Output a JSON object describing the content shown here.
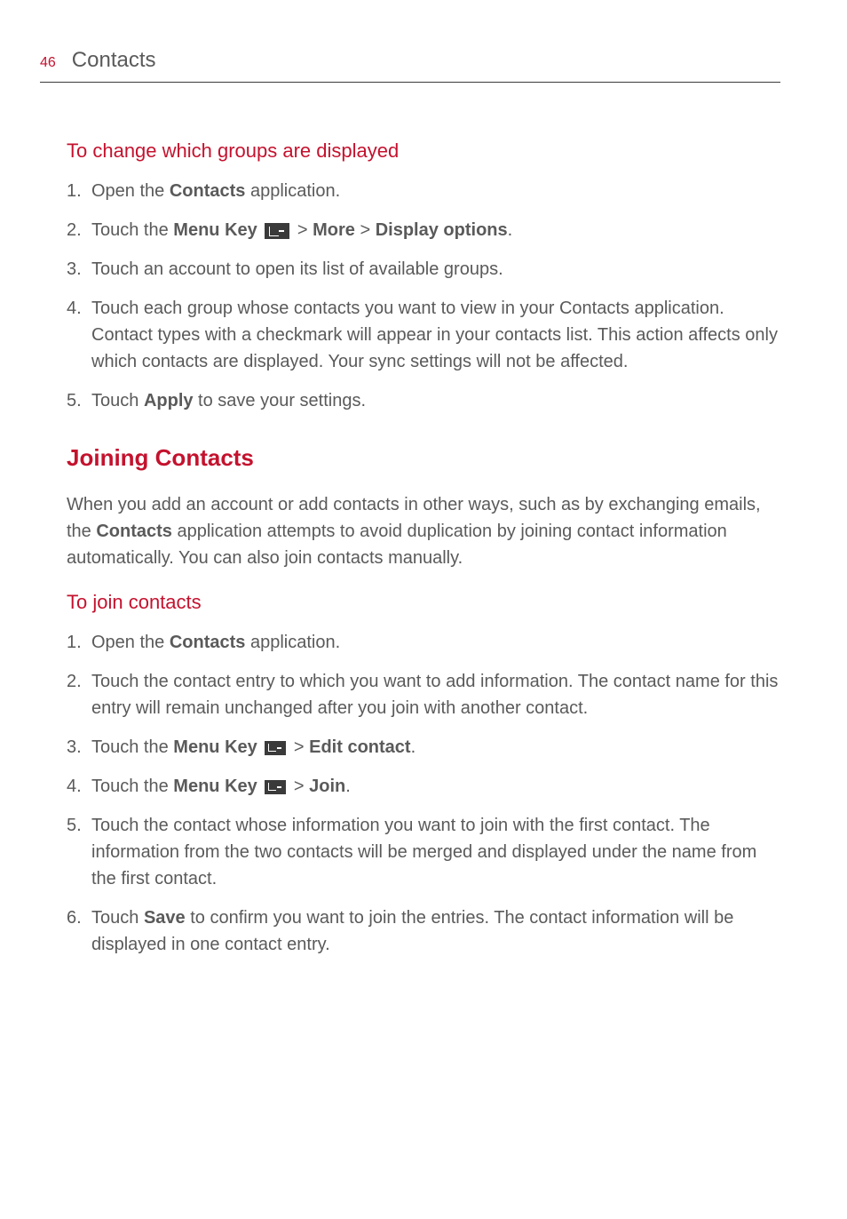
{
  "header": {
    "pageNumber": "46",
    "title": "Contacts"
  },
  "section1": {
    "heading": "To change which groups are displayed",
    "items": {
      "i1a": "Open the ",
      "i1b": "Contacts",
      "i1c": " application.",
      "i2a": "Touch the ",
      "i2b": "Menu Key",
      "i2c": " > ",
      "i2d": "More",
      "i2e": " > ",
      "i2f": "Display options",
      "i2g": ".",
      "i3": "Touch an account to open its list of available groups.",
      "i4": "Touch each group whose contacts you want to view in your Contacts application. Contact types with a checkmark will appear in your contacts list. This action affects only which contacts are displayed. Your sync settings will not be affected.",
      "i5a": "Touch ",
      "i5b": "Apply",
      "i5c": " to save your settings."
    }
  },
  "section2": {
    "heading": "Joining Contacts",
    "p1a": "When you add an account or add contacts in other ways, such as by exchanging emails, the ",
    "p1b": "Contacts",
    "p1c": " application attempts to avoid duplication by joining contact information automatically. You can also join contacts manually."
  },
  "section3": {
    "heading": "To join contacts",
    "items": {
      "i1a": "Open the ",
      "i1b": "Contacts",
      "i1c": " application.",
      "i2": "Touch the contact entry to which you want to add information. The contact name for this entry will remain unchanged after you join with another contact.",
      "i3a": "Touch the ",
      "i3b": "Menu Key",
      "i3c": " > ",
      "i3d": "Edit contact",
      "i3e": ".",
      "i4a": "Touch the ",
      "i4b": "Menu Key",
      "i4c": " > ",
      "i4d": "Join",
      "i4e": ".",
      "i5": "Touch the contact whose information you want to join with the first contact. The information from the two contacts will be merged and displayed under the name from the first contact.",
      "i6a": "Touch ",
      "i6b": "Save",
      "i6c": " to confirm you want to join the entries. The contact information will be displayed in one contact entry."
    }
  }
}
